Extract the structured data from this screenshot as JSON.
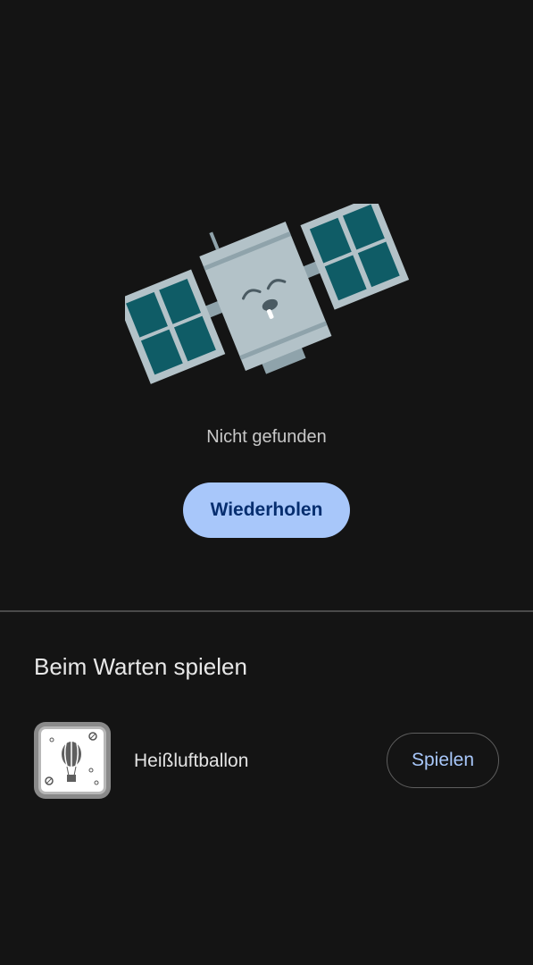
{
  "error": {
    "illustration": "sleeping-satellite-icon",
    "message": "Nicht gefunden",
    "retry_label": "Wiederholen"
  },
  "games_section": {
    "title": "Beim Warten spielen",
    "games": [
      {
        "icon": "hot-air-balloon-game-icon",
        "name": "Heißluftballon",
        "play_label": "Spielen"
      }
    ]
  },
  "colors": {
    "background": "#141414",
    "primary_button": "#a8c7fa",
    "primary_button_text": "#062e6f",
    "link_text": "#a8c7fa",
    "satellite_panel": "#0f5c66",
    "satellite_body": "#b3c2c8"
  }
}
